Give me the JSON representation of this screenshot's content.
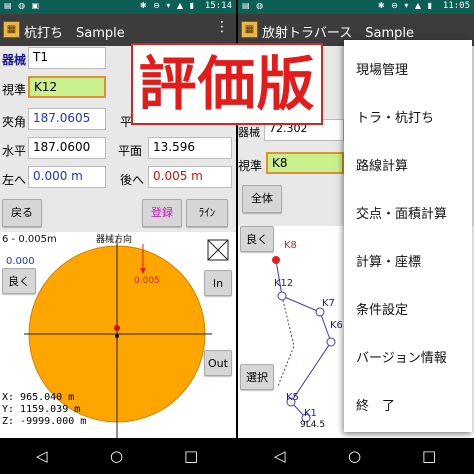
{
  "left": {
    "status": {
      "time": "15:14"
    },
    "app_title": "杭打ち　Sample",
    "more": "⋮",
    "labels": {
      "kikai": "器械",
      "shijun": "視準",
      "kyoukaku": "夾角",
      "suihei": "水平",
      "hidari": "左へ",
      "heimen": "平面",
      "ushiro": "後へ"
    },
    "fields": {
      "kikai": "T1",
      "shijun": "K12",
      "kyoukaku": "187.0605",
      "suihei": "187.0600",
      "hidari": "0.000 m",
      "heimen": "13.596",
      "ushiro": "0.005 m"
    },
    "buttons": {
      "back": "戻る",
      "register": "登録",
      "line": "ﾗｲﾝ",
      "good": "良く",
      "in": "In",
      "out": "Out"
    },
    "canvas": {
      "direction_label": "器械方向",
      "offset_label": "6 - 0.005m",
      "zero_label": "0.000",
      "arrow_value": "0.005",
      "coords": [
        "X:     965.040 m",
        "Y:   1159.039 m",
        "Z:  -9999.000 m"
      ],
      "circle_color": "#ffa500"
    }
  },
  "right": {
    "status": {
      "time": "11:05"
    },
    "app_title": "放射トラバース　Sample",
    "labels": {
      "kikai_partial": "器械",
      "shijun": "視準"
    },
    "fields": {
      "value_partial": "72.302",
      "shijun": "K8"
    },
    "buttons": {
      "all": "全体",
      "good": "良く",
      "select": "選択"
    },
    "points": [
      "K8",
      "K12",
      "K7",
      "K6",
      "K5",
      "K1"
    ],
    "partial_label": "9L4.5",
    "menu": [
      "現場管理",
      "トラ・杭打ち",
      "路線計算",
      "交点・面積計算",
      "計算・座標",
      "条件設定",
      "バージョン情報",
      "終　了"
    ]
  },
  "stamp": "評価版",
  "nav": {
    "back": "◁",
    "home": "○",
    "recent": "□"
  }
}
